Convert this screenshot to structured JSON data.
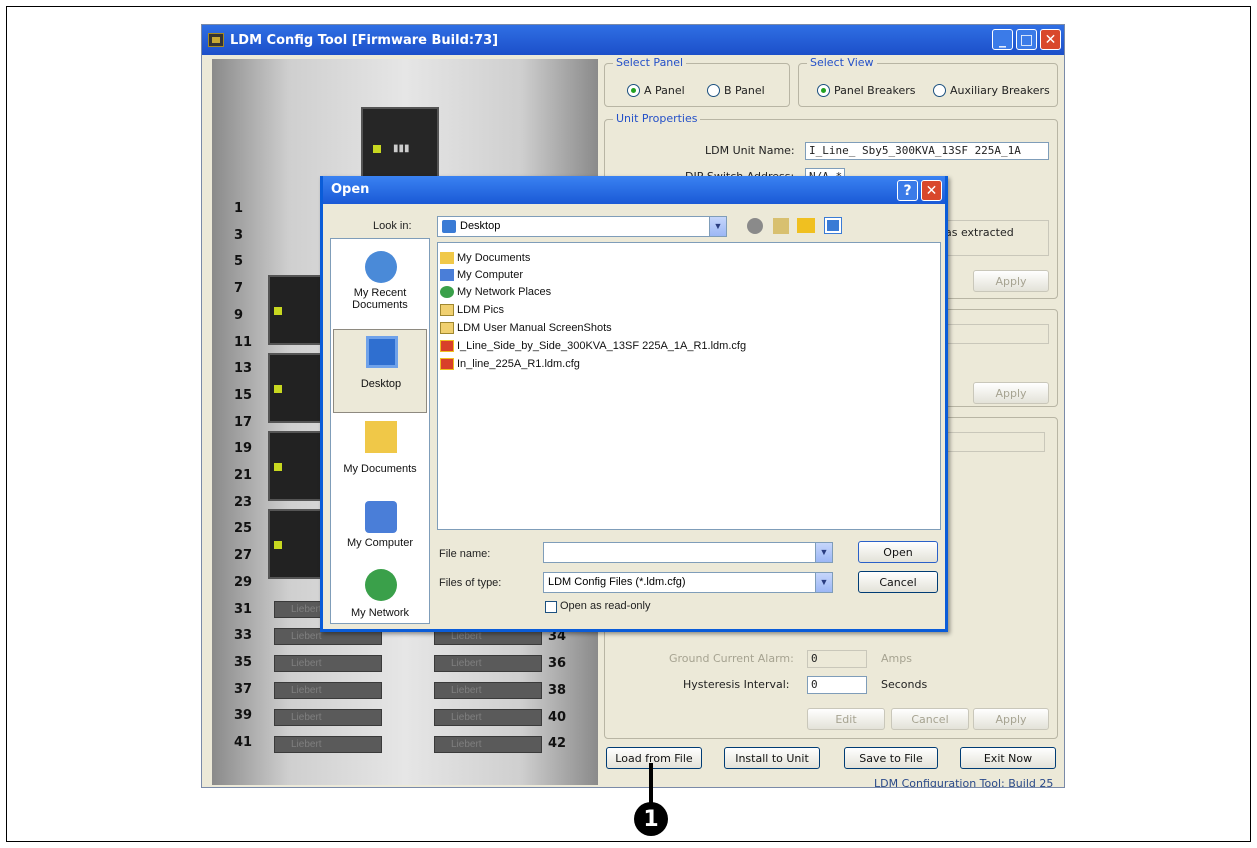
{
  "window": {
    "title": "LDM Config Tool [Firmware Build:73]"
  },
  "panel": {
    "left_numbers": [
      "1",
      "3",
      "5",
      "7",
      "9",
      "11",
      "13",
      "15",
      "17",
      "19",
      "21",
      "23",
      "25",
      "27",
      "29",
      "31",
      "33",
      "35",
      "37",
      "39",
      "41"
    ],
    "right_numbers": [
      "34",
      "36",
      "38",
      "40",
      "42"
    ],
    "slot_label": "Liebert"
  },
  "select_panel": {
    "label": "Select Panel",
    "options": [
      "A Panel",
      "B Panel"
    ],
    "selected": "A Panel"
  },
  "select_view": {
    "label": "Select View",
    "options": [
      "Panel Breakers",
      "Auxiliary Breakers"
    ],
    "selected": "Panel Breakers"
  },
  "unit_properties": {
    "label": "Unit Properties",
    "unit_name_label": "LDM Unit Name:",
    "unit_name_value": "I_Line_ Sby5_300KVA_13SF 225A_1A",
    "dip_label": "DIP Switch Address:",
    "dip_value": "N/A *",
    "extracted_text": "as extracted",
    "apply": "Apply"
  },
  "mid_group": {
    "apply": "Apply"
  },
  "alarms": {
    "ground_label": "Ground Current Alarm:",
    "ground_value": "0",
    "ground_unit": "Amps",
    "hyst_label": "Hysteresis Interval:",
    "hyst_value": "0",
    "hyst_unit": "Seconds",
    "edit": "Edit",
    "cancel": "Cancel",
    "apply": "Apply"
  },
  "bottom_buttons": {
    "load": "Load from File",
    "install": "Install to Unit",
    "save": "Save to File",
    "exit": "Exit Now"
  },
  "footer": "LDM Configuration Tool: Build 25",
  "dialog": {
    "title": "Open",
    "look_in_label": "Look in:",
    "look_in_value": "Desktop",
    "places": [
      "My Recent Documents",
      "Desktop",
      "My Documents",
      "My Computer",
      "My Network"
    ],
    "files": [
      {
        "name": "My Documents",
        "icon": "documents-folder-icon"
      },
      {
        "name": "My Computer",
        "icon": "computer-icon"
      },
      {
        "name": "My Network Places",
        "icon": "network-icon"
      },
      {
        "name": "LDM Pics",
        "icon": "folder-icon"
      },
      {
        "name": "LDM User Manual ScreenShots",
        "icon": "folder-icon"
      },
      {
        "name": "I_Line_Side_by_Side_300KVA_13SF 225A_1A_R1.ldm.cfg",
        "icon": "cfg-file-icon"
      },
      {
        "name": "In_line_225A_R1.ldm.cfg",
        "icon": "cfg-file-icon"
      }
    ],
    "file_name_label": "File name:",
    "file_name_value": "",
    "files_of_type_label": "Files of type:",
    "files_of_type_value": "LDM Config Files (*.ldm.cfg)",
    "read_only_label": "Open as read-only",
    "open": "Open",
    "cancel": "Cancel"
  },
  "callout": "1"
}
